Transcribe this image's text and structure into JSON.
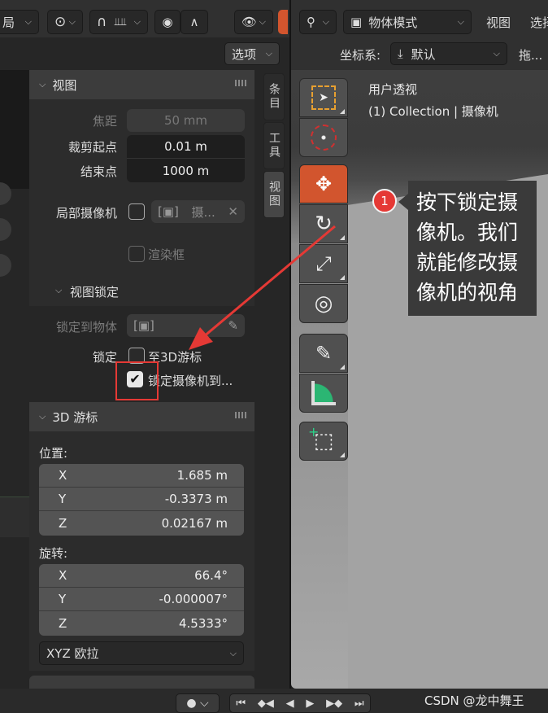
{
  "left_header": {
    "frag_label": "局",
    "options_label": "选项"
  },
  "right_header": {
    "mode_label": "物体模式",
    "menu_view": "视图",
    "menu_select": "选择",
    "coord_label": "坐标系:",
    "coord_value": "默认",
    "drag_label": "拖..."
  },
  "sidebar_tabs": [
    "条目",
    "工具",
    "视图"
  ],
  "view_panel": {
    "title": "视图",
    "focal_label": "焦距",
    "focal_value": "50 mm",
    "clip_start_label": "裁剪起点",
    "clip_start_value": "0.01 m",
    "clip_end_label": "结束点",
    "clip_end_value": "1000 m",
    "local_camera_label": "局部摄像机",
    "local_camera_value": "摄...",
    "render_region_label": "渲染框"
  },
  "view_lock": {
    "title": "视图锁定",
    "lock_object_label": "锁定到物体",
    "lock_label": "锁定",
    "to_cursor_label": "至3D游标",
    "lock_camera_label": "锁定摄像机到...",
    "lock_camera_checked": true
  },
  "cursor_panel": {
    "title": "3D 游标",
    "location_label": "位置:",
    "location": [
      {
        "axis": "X",
        "value": "1.685 m"
      },
      {
        "axis": "Y",
        "value": "-0.3373 m"
      },
      {
        "axis": "Z",
        "value": "0.02167 m"
      }
    ],
    "rotation_label": "旋转:",
    "rotation": [
      {
        "axis": "X",
        "value": "66.4°"
      },
      {
        "axis": "Y",
        "value": "-0.000007°"
      },
      {
        "axis": "Z",
        "value": "4.5333°"
      }
    ],
    "rotation_mode": "XYZ 欧拉"
  },
  "viewport": {
    "line1": "用户透视",
    "line2": "(1) Collection | 摄像机"
  },
  "annotation": {
    "number": "1",
    "text": "按下锁定摄像机。我们就能修改摄像机的视角"
  },
  "watermark": "CSDN @龙中舞王",
  "colors": {
    "accent": "#d2552e",
    "highlight_box": "#e53935",
    "arrow": "#e53935",
    "badge": "#e53935"
  }
}
